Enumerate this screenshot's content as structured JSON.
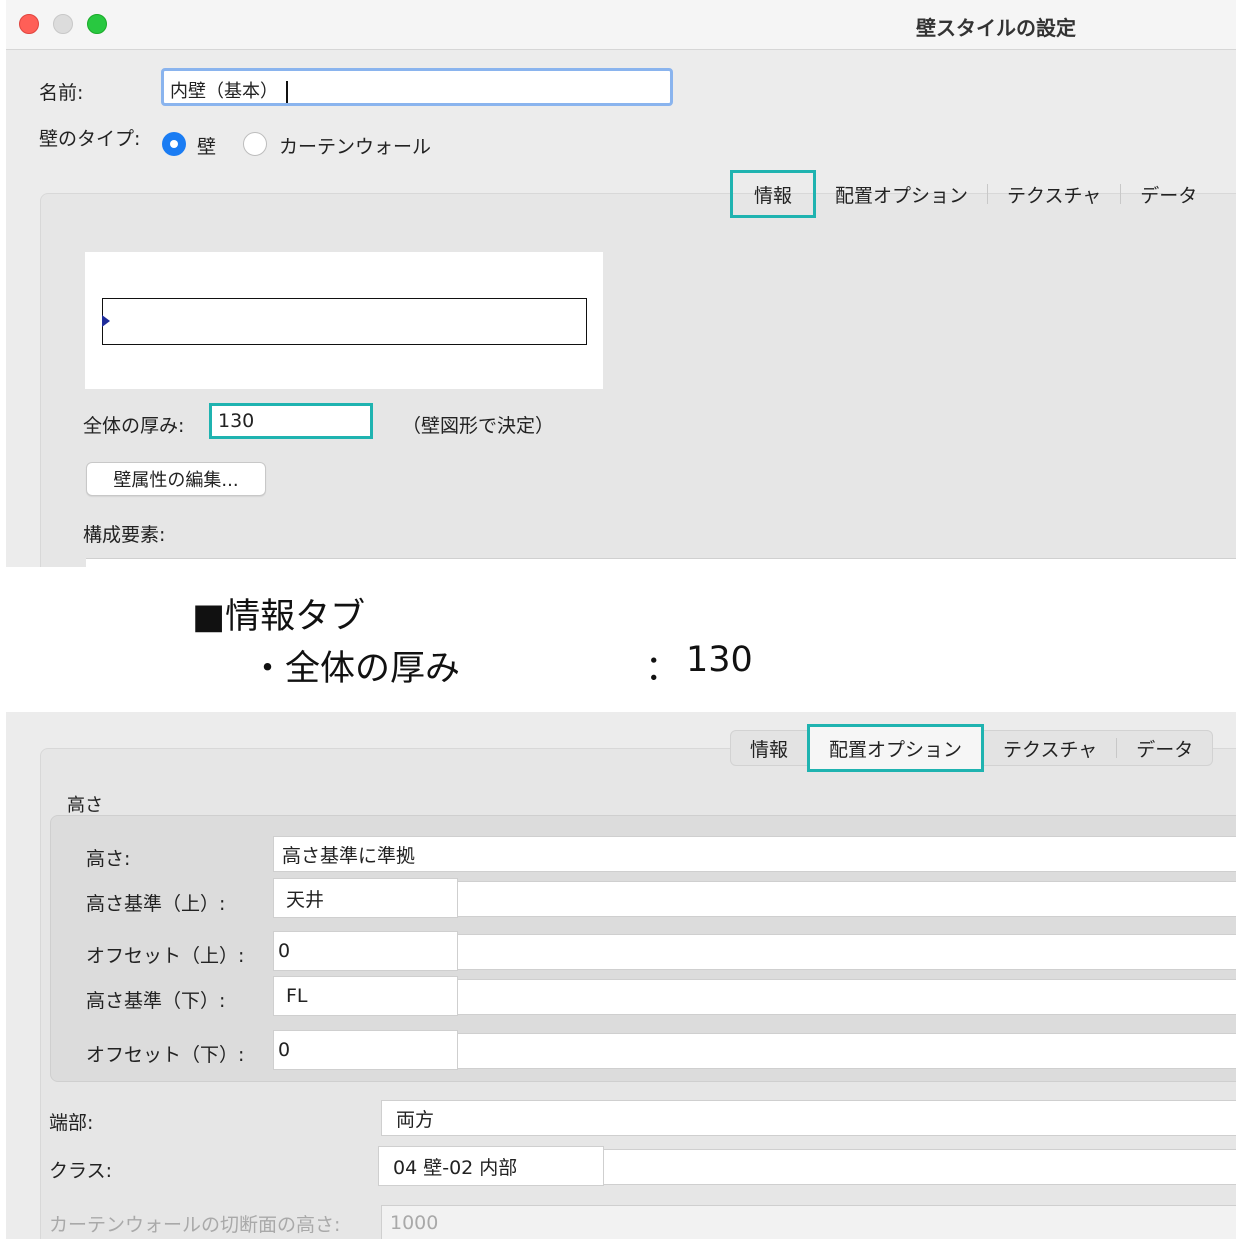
{
  "window": {
    "title": "壁スタイルの設定",
    "name_label": "名前:",
    "name_value": "内壁（基本）",
    "wall_type_label": "壁のタイプ:",
    "wall_type_options": [
      "壁",
      "カーテンウォール"
    ],
    "wall_type_selected": "壁"
  },
  "tabs": [
    "情報",
    "配置オプション",
    "テクスチャ",
    "データ"
  ],
  "info_tab": {
    "thickness_label": "全体の厚み:",
    "thickness_value": "130",
    "thickness_note": "（壁図形で決定）",
    "edit_button": "壁属性の編集...",
    "components_label": "構成要素:"
  },
  "caption": {
    "heading": "■情報タブ",
    "item_label": "・全体の厚み",
    "item_colon": "：",
    "item_value": "130"
  },
  "placement_tab": {
    "group_label": "高さ",
    "height_label": "高さ:",
    "height_value": "高さ基準に準拠",
    "top_ref_label": "高さ基準（上）:",
    "top_ref_value": "天井",
    "top_offset_label": "オフセット（上）:",
    "top_offset_value": "0",
    "bottom_ref_label": "高さ基準（下）:",
    "bottom_ref_value": "FL",
    "bottom_offset_label": "オフセット（下）:",
    "bottom_offset_value": "0",
    "end_label": "端部:",
    "end_value": "両方",
    "class_label": "クラス:",
    "class_value": "04 壁-02 内部",
    "curtain_cut_label": "カーテンウォールの切断面の高さ:",
    "curtain_cut_value": "1000"
  },
  "colors": {
    "highlight": "#1fb3b0",
    "radio_selected": "#1a7cf3",
    "focus_ring": "#8ab4ee"
  }
}
